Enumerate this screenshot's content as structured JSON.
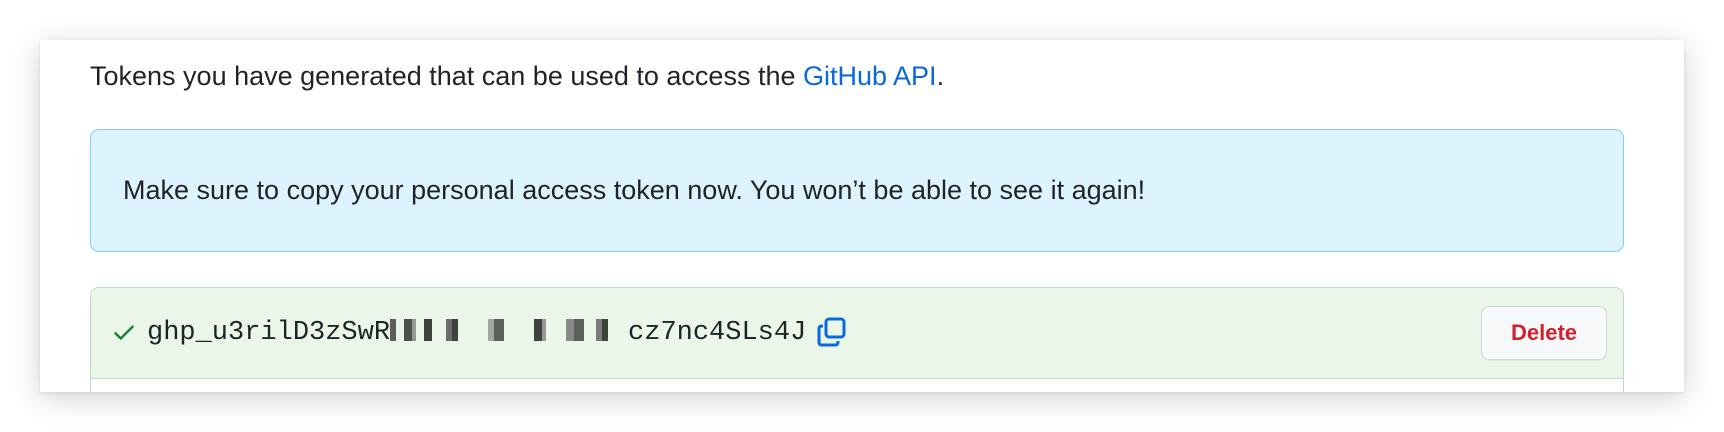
{
  "intro": {
    "text_before": "Tokens you have generated that can be used to access the ",
    "link_text": "GitHub API",
    "text_after": "."
  },
  "flash": {
    "message": "Make sure to copy your personal access token now. You won’t be able to see it again!"
  },
  "token": {
    "prefix": "ghp_u3rilD3zSwR",
    "suffix": "cz7nc4SLs4J",
    "status_icon": "check-icon",
    "copy_icon": "copy-icon",
    "delete_label": "Delete"
  },
  "colors": {
    "link": "#0969da",
    "flash_bg": "#ddf4ff",
    "flash_border": "#80ccff",
    "token_bg": "#eaf6e7",
    "check": "#1a7f37",
    "danger": "#cf222e"
  }
}
